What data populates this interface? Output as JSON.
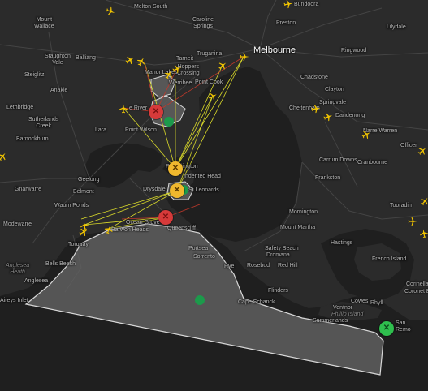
{
  "map": {
    "colors": {
      "water": "#1f1f1f",
      "land": "#2b2b2b",
      "road": "#444444",
      "zone_fill": "#5f5f5f",
      "zone_stroke": "#d8d8d8",
      "link_yellow": "#d9d92a",
      "link_red": "#c0392b",
      "plane": "#f2c500",
      "site_orange": "#f0b82e",
      "site_red": "#d63a3a",
      "site_green": "#2fbf4e",
      "small_dot_green": "#1c9a4b"
    },
    "labels": {
      "melbourne": "Melbourne",
      "melton_south": "Melton South",
      "bundoora": "Bundoora",
      "mount_wallace": "Mount\nWallace",
      "caroline_springs": "Caroline\nSprings",
      "preston": "Preston",
      "lilydale": "Lilydale",
      "staughton_vale": "Staughton\nVale",
      "balliang": "Balliang",
      "truganina": "Truganina",
      "ringwood": "Ringwood",
      "steiglitz": "Steiglitz",
      "anakie": "Anakie",
      "manor_lakes": "Manor Lakes",
      "tarneit": "Tarneit",
      "hoppers_crossing": "Hoppers\nCrossing",
      "werribee": "Werribee",
      "point_cook": "Point Cook",
      "chadstone": "Chadstone",
      "lethbridge": "Lethbridge",
      "avalon_river": "e River",
      "clayton": "Clayton",
      "sutherlands_creek": "Sutherlands\nCreek",
      "point_wilson": "Point Wilson",
      "lara": "Lara",
      "cheltenham": "Cheltenham",
      "springvale": "Springvale",
      "dandenong": "Dandenong",
      "narre_warren": "Narre Warren",
      "barnockburn": "Barnockburn",
      "carrum_downs": "Carrum Downs",
      "cranbourne": "Cranbourne",
      "officer": "Officer",
      "portarlington": "Portarlington",
      "indented_head": "Indented Head",
      "geelong": "Geelong",
      "frankston": "Frankston",
      "gnarwarre": "Gnarwarre",
      "belmont": "Belmont",
      "drysdale": "Drysdale",
      "st_leonards": "St Leonards",
      "waurn_ponds": "Waurn Ponds",
      "tooradin": "Tooradin",
      "mornington": "Mornington",
      "modewarre": "Modewarre",
      "ocean_grove": "Ocean Grove",
      "barwon_heads": "Barwon Heads",
      "queenscliff": "Queenscliff",
      "mount_martha": "Mount Martha",
      "torquay": "Torquay",
      "portsea": "Portsea",
      "sorrento": "Sorrento",
      "hastings": "Hastings",
      "safety_beach": "Safety Beach",
      "dromana": "Dromana",
      "bells_beach": "Bells Beach",
      "anglesea_heath": "Anglesea\nHeath",
      "rye": "Rye",
      "rosebud": "Rosebud",
      "red_hill": "Red Hill",
      "french_island": "French Island",
      "anglesea": "Anglesea",
      "flinders": "Flinders",
      "corinella": "Corinella",
      "coronet_bay": "Coronet Bay",
      "aireys_inlet": "Aireys Inlet",
      "cape_schanck": "Cape Schanck",
      "rhyll": "Rhyll",
      "cowes": "Cowes",
      "ventnor": "Ventnor",
      "phillip_island": "Phillip Island",
      "summerlands": "Summerlands",
      "san_remo": "San\nRemo"
    },
    "planes": [
      {
        "heading": 110
      },
      {
        "heading": 80
      },
      {
        "heading": 60
      },
      {
        "heading": 30
      },
      {
        "heading": 70
      },
      {
        "heading": 50
      },
      {
        "heading": 90
      },
      {
        "heading": 30
      },
      {
        "heading": 60
      },
      {
        "heading": 0
      },
      {
        "heading": 80
      },
      {
        "heading": 70
      },
      {
        "heading": 60
      },
      {
        "heading": 50
      },
      {
        "heading": 40
      },
      {
        "heading": 350
      },
      {
        "heading": 20
      },
      {
        "heading": 90
      },
      {
        "heading": 40
      },
      {
        "heading": 60
      },
      {
        "heading": 350
      }
    ],
    "sites": [
      {
        "status": "red",
        "icon": "drone-icon"
      },
      {
        "status": "orange",
        "icon": "drone-icon"
      },
      {
        "status": "orange",
        "icon": "drone-icon"
      },
      {
        "status": "red",
        "icon": "drone-icon"
      },
      {
        "status": "green",
        "icon": "drone-icon"
      }
    ]
  }
}
